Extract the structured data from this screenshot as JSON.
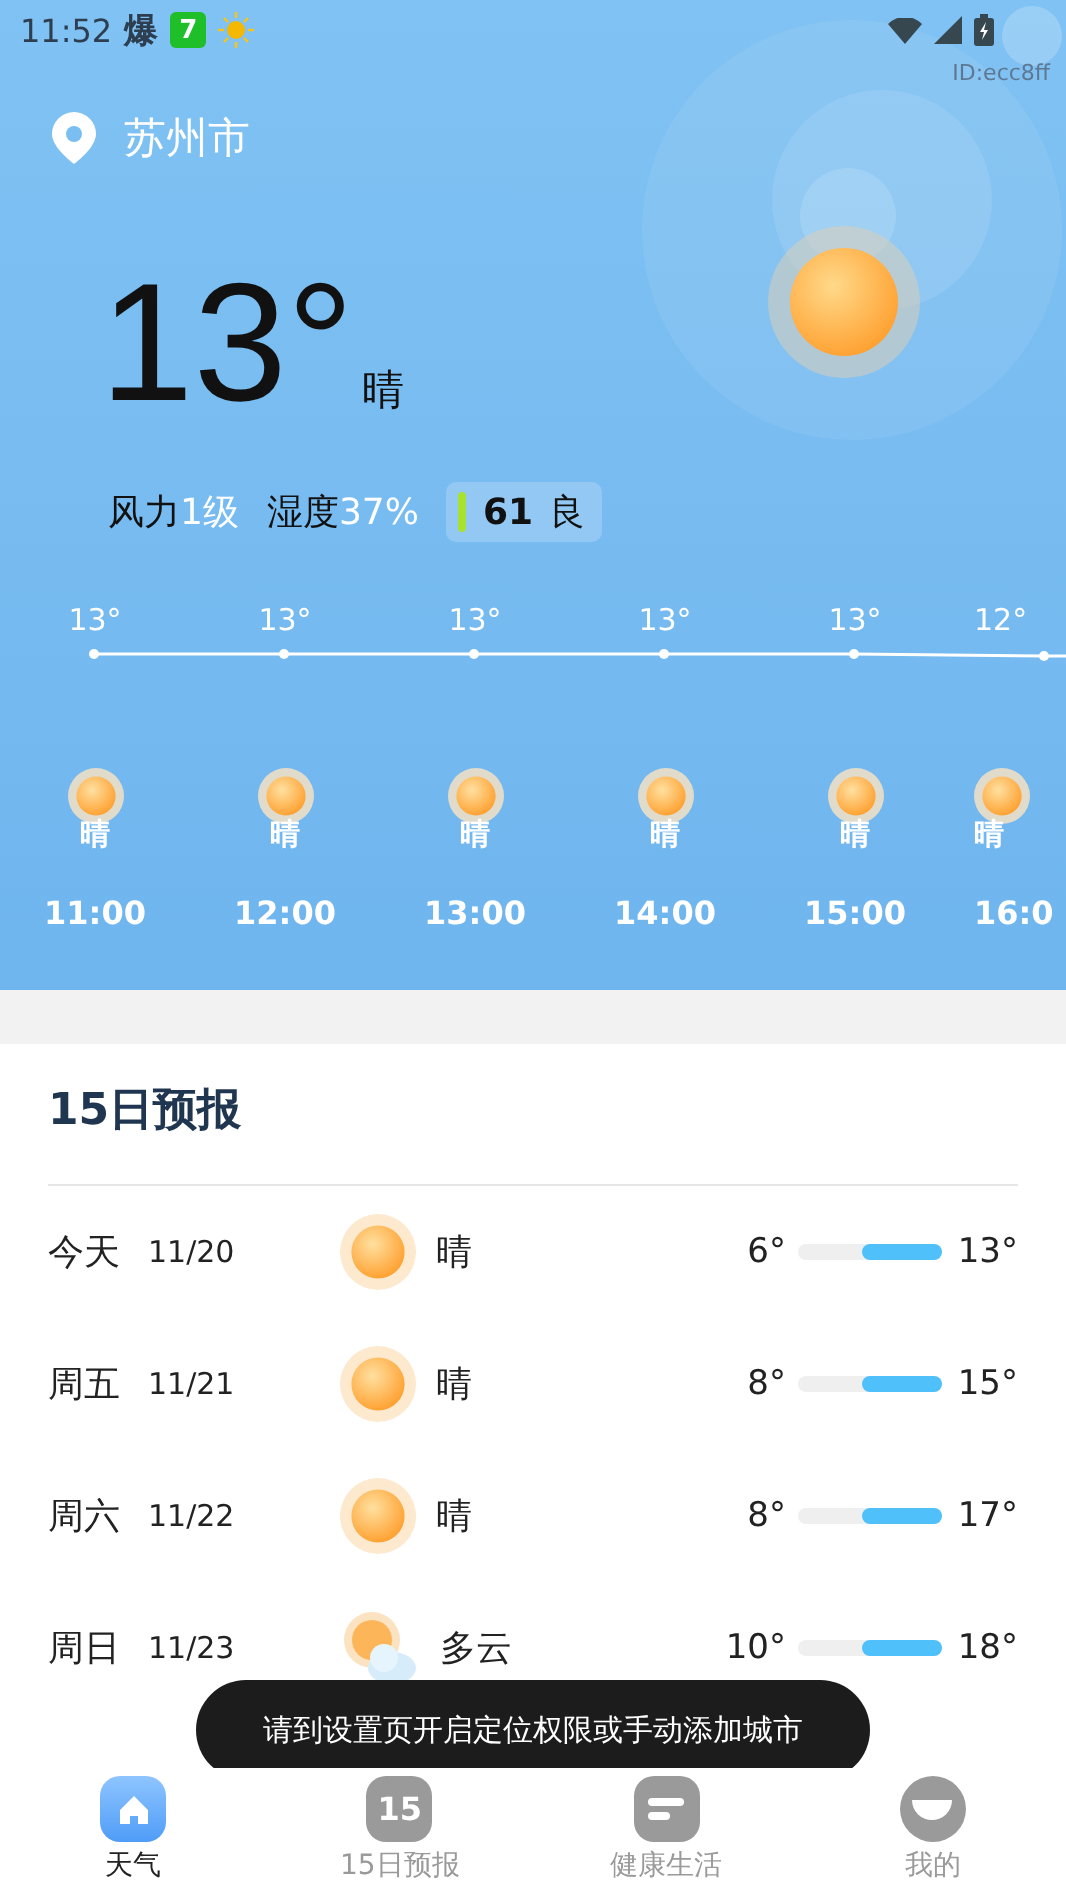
{
  "status_bar": {
    "time": "11:52",
    "notifications": [
      {
        "kind": "text",
        "label": "爆"
      },
      {
        "kind": "badge",
        "label": "7"
      },
      {
        "kind": "sun"
      }
    ]
  },
  "device_id": "ID:ecc8ff",
  "city": "苏州市",
  "current": {
    "temperature": "13°",
    "condition": "晴",
    "wind_label": "风力",
    "wind_value": "1级",
    "humidity_label": "湿度",
    "humidity_value": "37%",
    "aqi_value": "61",
    "aqi_label": "良"
  },
  "hourly": [
    {
      "temp": "13°",
      "condition": "晴",
      "time": "11:00"
    },
    {
      "temp": "13°",
      "condition": "晴",
      "time": "12:00"
    },
    {
      "temp": "13°",
      "condition": "晴",
      "time": "13:00"
    },
    {
      "temp": "13°",
      "condition": "晴",
      "time": "14:00"
    },
    {
      "temp": "13°",
      "condition": "晴",
      "time": "15:00"
    },
    {
      "temp": "12°",
      "condition": "晴",
      "time": "16:0"
    }
  ],
  "forecast": {
    "title": "15日预报",
    "days": [
      {
        "day": "今天",
        "date": "11/20",
        "kind": "sunny",
        "condition": "晴",
        "low": "6°",
        "high": "13°",
        "level": 0.55
      },
      {
        "day": "周五",
        "date": "11/21",
        "kind": "sunny",
        "condition": "晴",
        "low": "8°",
        "high": "15°",
        "level": 0.55
      },
      {
        "day": "周六",
        "date": "11/22",
        "kind": "sunny",
        "condition": "晴",
        "low": "8°",
        "high": "17°",
        "level": 0.55
      },
      {
        "day": "周日",
        "date": "11/23",
        "kind": "cloudy",
        "condition": "多云",
        "low": "10°",
        "high": "18°",
        "level": 0.55
      }
    ]
  },
  "toast": "请到设置页开启定位权限或手动添加城市",
  "tabs": [
    {
      "kind": "home",
      "label": "天气",
      "selected": true
    },
    {
      "kind": "fifteen",
      "icon_text": "15",
      "label": "15日预报",
      "selected": false
    },
    {
      "kind": "health",
      "label": "健康生活",
      "selected": false
    },
    {
      "kind": "me",
      "label": "我的",
      "selected": false
    }
  ]
}
